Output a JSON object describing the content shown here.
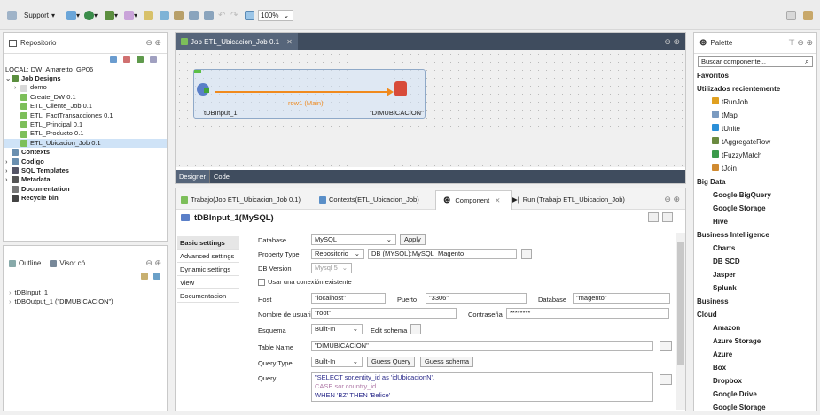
{
  "toolbar": {
    "support_label": "Support",
    "zoom": "100%"
  },
  "repo": {
    "title": "Repositorio",
    "local": "LOCAL: DW_Amaretto_GP06",
    "items": [
      {
        "label": "Job Designs",
        "bold": true
      },
      {
        "label": "demo"
      },
      {
        "label": "Create_DW 0.1"
      },
      {
        "label": "ETL_Cliente_Job 0.1"
      },
      {
        "label": "ETL_FactTransacciones 0.1"
      },
      {
        "label": "ETL_Principal 0.1"
      },
      {
        "label": "ETL_Producto 0.1"
      },
      {
        "label": "ETL_Ubicacion_Job 0.1"
      },
      {
        "label": "Contexts"
      },
      {
        "label": "Codigo"
      },
      {
        "label": "SQL Templates"
      },
      {
        "label": "Metadata"
      },
      {
        "label": "Documentation"
      },
      {
        "label": "Recycle bin"
      }
    ]
  },
  "outline": {
    "tab1": "Outline",
    "tab2": "Visor có...",
    "items": [
      "tDBInput_1",
      "tDBOutput_1 (\"DIMUBICACION\")"
    ]
  },
  "job": {
    "tab": "Job ETL_Ubicacion_Job 0.1",
    "node1": "tDBInput_1",
    "link": "row1 (Main)",
    "node2": "\"DIMUBICACION\"",
    "designer": "Designer",
    "code": "Code"
  },
  "bottom": {
    "tabs": [
      "Trabajo(Job ETL_Ubicacion_Job 0.1)",
      "Contexts(ETL_Ubicacion_Job)",
      "Component",
      "Run (Trabajo ETL_Ubicacion_Job)"
    ],
    "title": "tDBInput_1(MySQL)",
    "side": [
      "Basic settings",
      "Advanced settings",
      "Dynamic settings",
      "View",
      "Documentacion"
    ],
    "f": {
      "database_lbl": "Database",
      "database": "MySQL",
      "apply": "Apply",
      "ptype_lbl": "Property Type",
      "ptype": "Repositorio",
      "ptype_val": "DB (MYSQL):MySQL_Magento",
      "dbver_lbl": "DB Version",
      "dbver": "Mysql 5",
      "existing": "Usar una conexión existente",
      "host_lbl": "Host",
      "host": "\"localhost\"",
      "port_lbl": "Puerto",
      "port": "\"3306\"",
      "db_lbl": "Database",
      "db": "\"magento\"",
      "user_lbl": "Nombre de usuario",
      "user": "\"root\"",
      "pass_lbl": "Contraseña",
      "pass": "********",
      "schema_lbl": "Esquema",
      "schema": "Built-In",
      "edit_schema": "Edit schema",
      "table_lbl": "Table Name",
      "table": "\"DIMUBICACION\"",
      "qtype_lbl": "Query Type",
      "qtype": "Built-In",
      "guess_query": "Guess Query",
      "guess_schema": "Guess schema",
      "query_lbl": "Query",
      "q1": "\"SELECT sor.entity_id as 'idUbicacionN',",
      "q2": "CASE sor.country_id",
      "q3": "WHEN 'BZ' THEN 'Belice'"
    }
  },
  "palette": {
    "title": "Palette",
    "search": "Buscar componente...",
    "items": [
      {
        "label": "Favoritos",
        "k": "cat"
      },
      {
        "label": "Utilizados recientemente",
        "k": "cat"
      },
      {
        "label": "tRunJob",
        "k": "sub"
      },
      {
        "label": "tMap",
        "k": "sub"
      },
      {
        "label": "tUnite",
        "k": "sub"
      },
      {
        "label": "tAggregateRow",
        "k": "sub"
      },
      {
        "label": "tFuzzyMatch",
        "k": "sub"
      },
      {
        "label": "tJoin",
        "k": "sub"
      },
      {
        "label": "Big Data",
        "k": "cat"
      },
      {
        "label": "Google BigQuery",
        "k": "sub2"
      },
      {
        "label": "Google Storage",
        "k": "sub2"
      },
      {
        "label": "Hive",
        "k": "sub2"
      },
      {
        "label": "Business Intelligence",
        "k": "cat"
      },
      {
        "label": "Charts",
        "k": "sub2"
      },
      {
        "label": "DB SCD",
        "k": "sub2"
      },
      {
        "label": "Jasper",
        "k": "sub2"
      },
      {
        "label": "Splunk",
        "k": "sub2"
      },
      {
        "label": "Business",
        "k": "cat"
      },
      {
        "label": "Cloud",
        "k": "cat"
      },
      {
        "label": "Amazon",
        "k": "sub2"
      },
      {
        "label": "Azure Storage",
        "k": "sub2"
      },
      {
        "label": "Azure",
        "k": "sub2"
      },
      {
        "label": "Box",
        "k": "sub2"
      },
      {
        "label": "Dropbox",
        "k": "sub2"
      },
      {
        "label": "Google Drive",
        "k": "sub2"
      },
      {
        "label": "Google Storage",
        "k": "sub2"
      }
    ]
  }
}
